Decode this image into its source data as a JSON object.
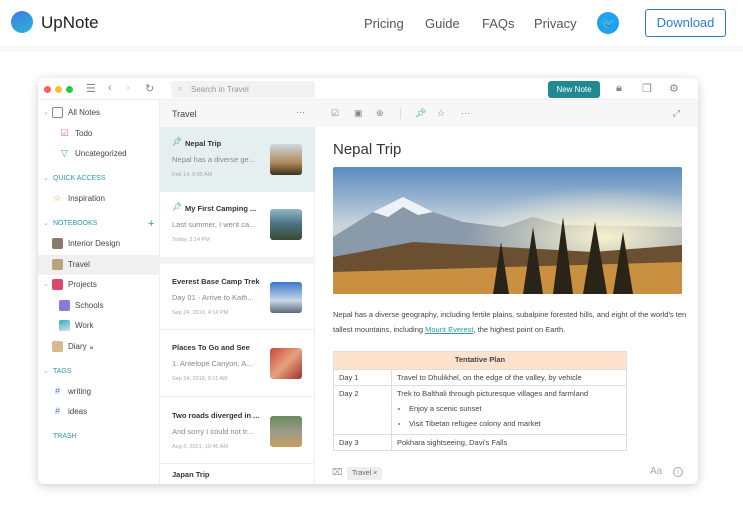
{
  "site": {
    "brand": "UpNote",
    "nav": [
      "Pricing",
      "Guide",
      "FAQs",
      "Privacy"
    ],
    "download": "Download"
  },
  "app": {
    "search_placeholder": "Search in Travel",
    "new_note": "New Note",
    "sidebar": {
      "all_notes": "All Notes",
      "todo": "Todo",
      "uncategorized": "Uncategorized",
      "quick_access": "QUICK ACCESS",
      "inspiration": "Inspiration",
      "notebooks": "NOTEBOOKS",
      "notebook_items": [
        "Interior Design",
        "Travel",
        "Projects",
        "Schools",
        "Work",
        "Diary"
      ],
      "tags_header": "TAGS",
      "tags": [
        "writing",
        "ideas"
      ],
      "trash": "TRASH"
    },
    "list": {
      "title": "Travel",
      "notes": [
        {
          "title": "Nepal Trip",
          "preview": "Nepal has a diverse ge...",
          "date": "Feb 14, 9:05 AM"
        },
        {
          "title": "My First Camping ...",
          "preview": "Last summer, I went ca...",
          "date": "Today, 3:14 PM"
        },
        {
          "title": "Everest Base Camp Trek",
          "preview": "Day 01 - Arrive to Kath...",
          "date": "Sep 24, 2019, 4:14 PM"
        },
        {
          "title": "Places To Go and See",
          "preview": "1. Antelope Canyon, A...",
          "date": "Sep 24, 2019, 9:11 AM"
        },
        {
          "title": "Two roads diverged in ...",
          "preview": "And sorry I could not tr...",
          "date": "Aug 3, 2021, 10:45 AM"
        },
        {
          "title": "Japan Trip"
        }
      ]
    },
    "editor": {
      "title": "Nepal Trip",
      "para_a": "Nepal has a diverse geography, including fertile plains, subalpine forested hills, and eight of the world's ten tallest mountains, including ",
      "link": "Mount Everest",
      "para_b": ", the highest point on Earth.",
      "table": {
        "header": "Tentative Plan",
        "rows": [
          [
            "Day 1",
            "Travel to Dhulikhel, on the edge of the valley, by vehicle"
          ],
          [
            "Day 2",
            "Trek to Balthali through picturesque villages and farmland"
          ],
          [
            "Day 3",
            "Pokhara sightseeing, Davi's Falls"
          ]
        ],
        "bullets": [
          "Enjoy a scenic sunset",
          "Visit Tibetan refugee colony and market"
        ]
      },
      "tag": "Travel ×",
      "font_btn": "Aa"
    }
  }
}
